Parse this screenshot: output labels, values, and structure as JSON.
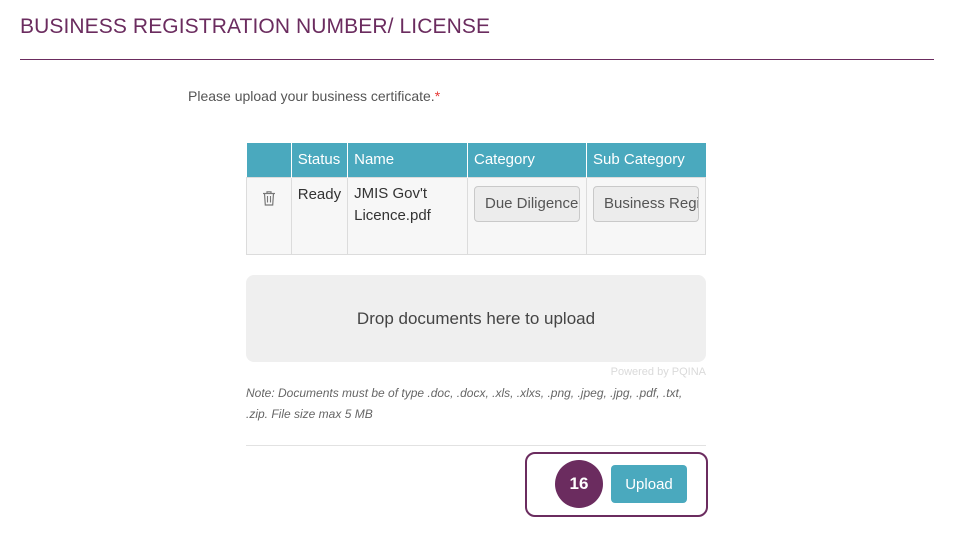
{
  "section": {
    "title": "BUSINESS REGISTRATION NUMBER/ LICENSE"
  },
  "upload": {
    "prompt": "Please upload your business certificate.",
    "required_marker": "*",
    "columns": [
      "Status",
      "Name",
      "Category",
      "Sub Category"
    ],
    "rows": [
      {
        "status": "Ready",
        "name": "JMIS Gov't Licence.pdf",
        "category": "Due Diligence",
        "sub_category": "Business Registration"
      }
    ],
    "dropzone_label": "Drop documents here to upload",
    "powered_by": "Powered by PQINA",
    "note": "Note: Documents must be of type .doc, .docx, .xls, .xlxs, .png, .jpeg, .jpg, .pdf, .txt, .zip. File size max 5 MB",
    "step_number": "16",
    "upload_label": "Upload"
  },
  "colors": {
    "accent_purple": "#6b2c5f",
    "header_teal": "#4aa9be",
    "required_red": "#e53935"
  },
  "icons": {
    "delete": "trash-icon"
  }
}
